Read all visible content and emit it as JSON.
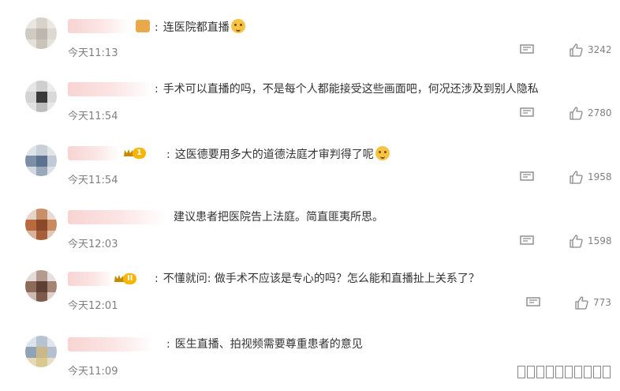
{
  "comments": [
    {
      "text": "连医院都直播",
      "has_emoji": true,
      "time": "今天11:13",
      "likes": "3242"
    },
    {
      "text": "手术可以直播的吗，不是每个人都能接受这些画面吧，何况还涉及到别人隐私",
      "has_emoji": false,
      "time": "今天11:54",
      "likes": "2780"
    },
    {
      "text": "这医德要用多大的道德法庭才审判得了呢",
      "has_emoji": true,
      "time": "今天11:54",
      "likes": "1958",
      "badge_level": "1"
    },
    {
      "text": "建议患者把医院告上法庭。简直匪夷所思。",
      "has_emoji": false,
      "time": "今天12:03",
      "likes": "1598"
    },
    {
      "text": "不懂就问: 做手术不应该是专心的吗？怎么能和直播扯上关系了？",
      "has_emoji": false,
      "time": "今天12:01",
      "likes": "773",
      "badge_level": "II"
    },
    {
      "text": "医生直播、拍视频需要尊重患者的意见",
      "has_emoji": false,
      "time": "今天11:09",
      "likes": ""
    }
  ],
  "colors": {
    "badge": "#f7b500",
    "time": "#808080",
    "text": "#333333"
  },
  "icons": {
    "reply": "comment-icon",
    "like": "thumbs-up-icon",
    "badge": "crown-icon"
  }
}
